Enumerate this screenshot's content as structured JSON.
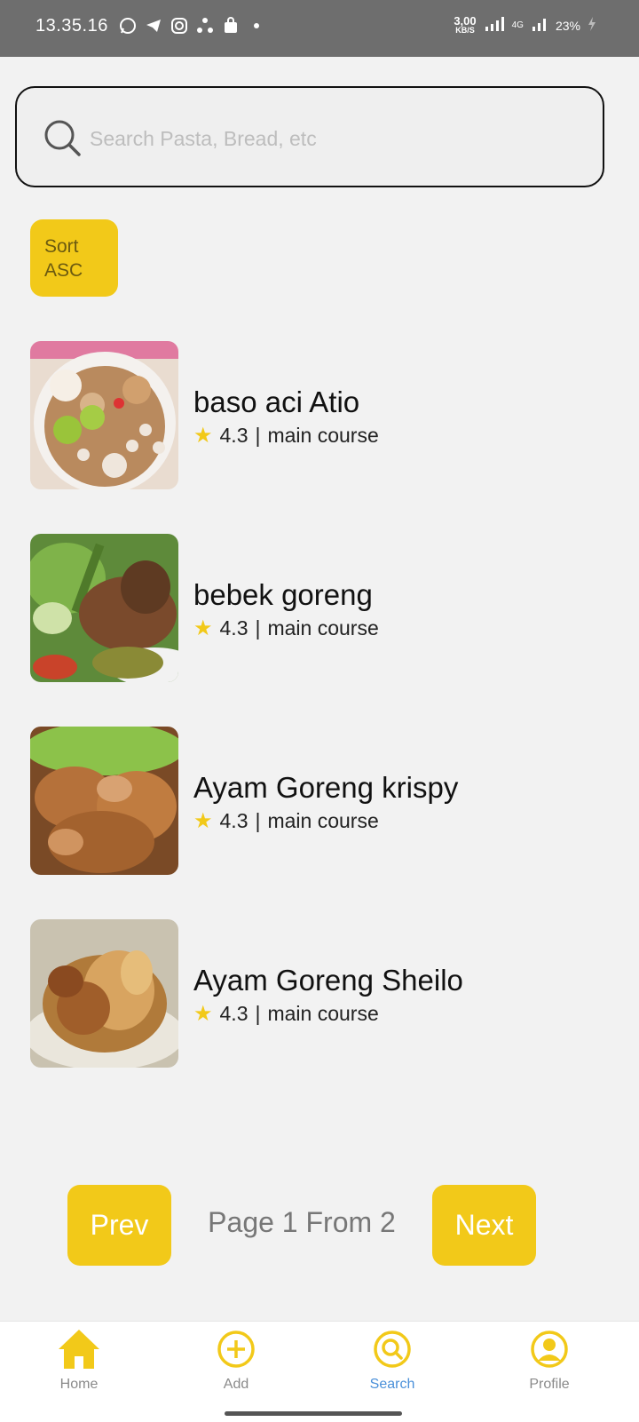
{
  "status_bar": {
    "time": "13.35.16",
    "net_speed": "3,00",
    "net_unit": "KB/S",
    "network": "4G",
    "battery": "23%"
  },
  "search": {
    "placeholder": "Search Pasta, Bread, etc",
    "value": ""
  },
  "sort": {
    "label": "Sort ASC"
  },
  "recipes": [
    {
      "name": "baso aci Atio",
      "rating": "4.3",
      "separator": "|",
      "category": "main course"
    },
    {
      "name": "bebek goreng",
      "rating": "4.3",
      "separator": "|",
      "category": "main course"
    },
    {
      "name": "Ayam Goreng krispy",
      "rating": "4.3",
      "separator": "|",
      "category": "main course"
    },
    {
      "name": "Ayam Goreng Sheilo",
      "rating": "4.3",
      "separator": "|",
      "category": "main course"
    }
  ],
  "pagination": {
    "prev_label": "Prev",
    "next_label": "Next",
    "page_text": "Page 1 From 2"
  },
  "bottom_nav": {
    "items": [
      {
        "label": "Home",
        "icon": "home-icon"
      },
      {
        "label": "Add",
        "icon": "add-icon"
      },
      {
        "label": "Search",
        "icon": "search-icon"
      },
      {
        "label": "Profile",
        "icon": "profile-icon"
      }
    ],
    "active": "Search"
  },
  "colors": {
    "accent": "#f2c919",
    "active_nav": "#4a90d9",
    "background": "#f2f2f2"
  }
}
